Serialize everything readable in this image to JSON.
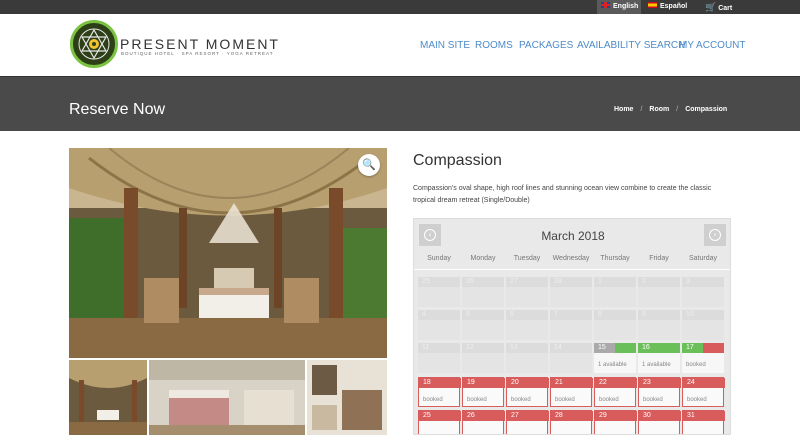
{
  "topbar": {
    "lang_en": "English",
    "lang_es": "Español",
    "cart": "Cart"
  },
  "brand": {
    "name": "PRESENT MOMENT",
    "tagline": "BOUTIQUE HOTEL · SPA RESORT · YOGA RETREAT"
  },
  "nav": [
    "MAIN SITE",
    "ROOMS",
    "PACKAGES",
    "AVAILABILITY SEARCH",
    "MY ACCOUNT"
  ],
  "banner": {
    "title": "Reserve Now",
    "breadcrumbs": [
      "Home",
      "Room",
      "Compassion"
    ]
  },
  "product": {
    "title": "Compassion",
    "description": "Compassion's oval shape, high roof lines and stunning ocean view combine to create the classic tropical dream retreat (Single/Double)"
  },
  "calendar": {
    "month": "March 2018",
    "weekdays": [
      "Sunday",
      "Monday",
      "Tuesday",
      "Wednesday",
      "Thursday",
      "Friday",
      "Saturday"
    ],
    "rows": [
      [
        {
          "d": "25",
          "s": "past"
        },
        {
          "d": "26",
          "s": "past"
        },
        {
          "d": "27",
          "s": "past"
        },
        {
          "d": "28",
          "s": "past"
        },
        {
          "d": "1",
          "s": "past"
        },
        {
          "d": "2",
          "s": "past"
        },
        {
          "d": "3",
          "s": "past"
        }
      ],
      [
        {
          "d": "4",
          "s": "past"
        },
        {
          "d": "5",
          "s": "past"
        },
        {
          "d": "6",
          "s": "past"
        },
        {
          "d": "7",
          "s": "past"
        },
        {
          "d": "8",
          "s": "past"
        },
        {
          "d": "9",
          "s": "past"
        },
        {
          "d": "10",
          "s": "past"
        }
      ],
      [
        {
          "d": "11",
          "s": "past"
        },
        {
          "d": "12",
          "s": "past"
        },
        {
          "d": "13",
          "s": "past"
        },
        {
          "d": "14",
          "s": "past"
        },
        {
          "d": "15",
          "s": "halfg",
          "note": "1 available"
        },
        {
          "d": "16",
          "s": "avail",
          "note": "1 available"
        },
        {
          "d": "17",
          "s": "half",
          "note": "booked"
        }
      ],
      [
        {
          "d": "18",
          "s": "booked",
          "note": "booked"
        },
        {
          "d": "19",
          "s": "booked",
          "note": "booked"
        },
        {
          "d": "20",
          "s": "booked",
          "note": "booked"
        },
        {
          "d": "21",
          "s": "booked",
          "note": "booked"
        },
        {
          "d": "22",
          "s": "booked",
          "note": "booked"
        },
        {
          "d": "23",
          "s": "booked",
          "note": "booked"
        },
        {
          "d": "24",
          "s": "booked",
          "note": "booked"
        }
      ],
      [
        {
          "d": "25",
          "s": "booked"
        },
        {
          "d": "26",
          "s": "booked"
        },
        {
          "d": "27",
          "s": "booked"
        },
        {
          "d": "28",
          "s": "booked"
        },
        {
          "d": "29",
          "s": "booked"
        },
        {
          "d": "30",
          "s": "booked"
        },
        {
          "d": "31",
          "s": "booked"
        }
      ]
    ]
  },
  "colors": {
    "nav_link": "#4d8bc8",
    "available": "#6bbf59",
    "booked": "#d85c5c",
    "banner": "#4a4a4a",
    "topbar": "#3a3a3a"
  },
  "icons": {
    "zoom": "magnifier-icon",
    "cart": "cart-icon",
    "prev": "chevron-left-icon",
    "next": "chevron-right-icon"
  }
}
